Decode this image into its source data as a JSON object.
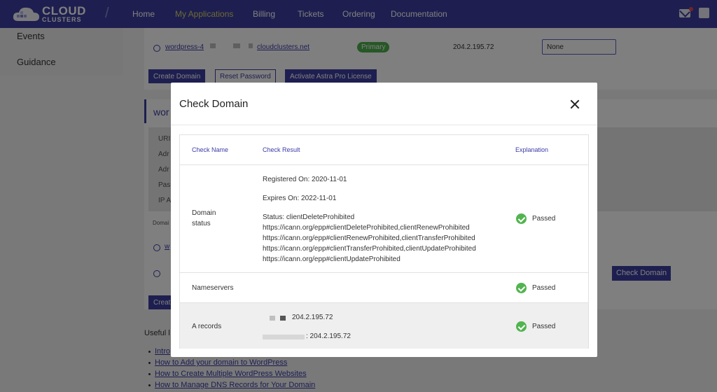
{
  "nav": {
    "logo_line1": "CLOUD",
    "logo_line2": "CLUSTERS",
    "items": [
      "Home",
      "My Applications",
      "Billing",
      "Tickets",
      "Ordering",
      "Documentation"
    ]
  },
  "sidebar": {
    "items": [
      "Events",
      "Guidance"
    ]
  },
  "background": {
    "domain_link_prefix": "wordpress-4",
    "domain_link_suffix": "cloudclusters.net",
    "primary_badge": "Primary",
    "ip": "204.2.195.72",
    "select_value": "None",
    "buttons": {
      "create_domain": "Create Domain",
      "reset_password": "Reset Password",
      "activate_astra": "Activate Astra Pro License",
      "create_stub": "Creat"
    },
    "section_title_stub": "wor",
    "stub_labels": [
      "URI",
      "Adr",
      "Adr",
      "Pas",
      "IP A"
    ],
    "domain_stub": "Domai",
    "w_stub": "w",
    "check_domain_button": "Check Domain",
    "useful_heading": "Useful l",
    "useful_links": [
      "Intro",
      "How to Add your domain to WordPress",
      "How to Create Multiple WordPress Websites",
      "How to Manage DNS Records for Your Domain"
    ]
  },
  "modal": {
    "title": "Check Domain",
    "headers": {
      "name": "Check Name",
      "result": "Check Result",
      "explanation": "Explanation"
    },
    "rows": [
      {
        "name_line1": "Domain",
        "name_line2": "status",
        "result_lines": [
          "Registered On: 2020-11-01",
          "Expires On: 2022-11-01",
          "Status: clientDeleteProhibited",
          "https://icann.org/epp#clientDeleteProhibited,clientRenewProhibited",
          "https://icann.org/epp#clientRenewProhibited,clientTransferProhibited",
          "https://icann.org/epp#clientTransferProhibited,clientUpdateProhibited",
          "https://icann.org/epp#clientUpdateProhibited"
        ],
        "explanation": "Passed"
      },
      {
        "name": "Nameservers",
        "explanation": "Passed"
      },
      {
        "name": "A records",
        "result_lines": [
          "204.2.195.72",
          ": 204.2.195.72"
        ],
        "explanation": "Passed"
      }
    ]
  },
  "colors": {
    "primary": "#3d3fa0",
    "success": "#52b44f",
    "link": "#3b3ba8"
  }
}
